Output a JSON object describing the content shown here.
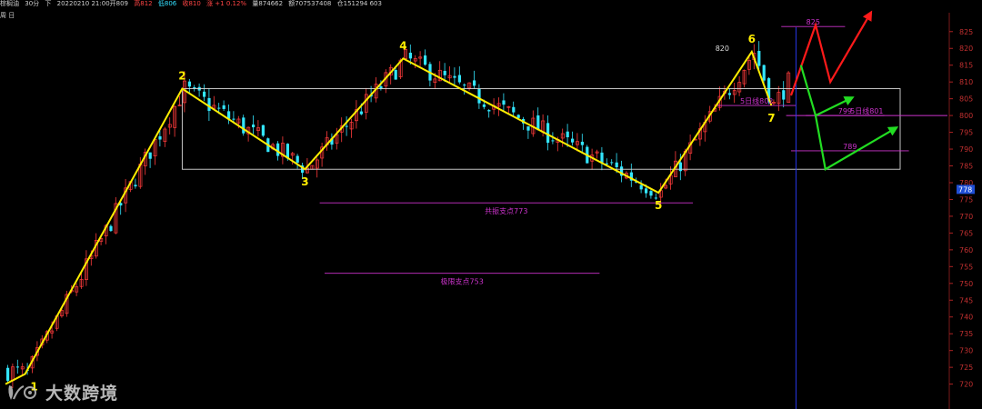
{
  "header": {
    "name": "棕榈油",
    "period": "30分",
    "arrow": "下",
    "datetime": "20220210 21:00开809",
    "high": "高812",
    "low": "低806",
    "close": "收810",
    "change": "涨 +1 0.12%",
    "volume": "量874662",
    "amount": "额707537408",
    "oi": "仓151294 603",
    "sub_label": "周 日"
  },
  "watermark": {
    "text": "大数跨境",
    "logo": "dashu-logo-icon"
  },
  "colors": {
    "background": "#000000",
    "up": "#ff3b3b",
    "down": "#33e6ff",
    "wave": "#ffee00",
    "level": "#cc33cc",
    "box": "#d8d8d8",
    "red_arrow": "#ff1a1a",
    "green_arrow": "#22dd22",
    "price_tag": "#1f4fd6",
    "vline": "#2a3cff"
  },
  "chart_data": {
    "type": "candlestick",
    "ylim": [
      718,
      829
    ],
    "y_ticks": [
      720,
      725,
      730,
      735,
      740,
      745,
      750,
      755,
      760,
      765,
      770,
      775,
      780,
      785,
      790,
      795,
      800,
      805,
      810,
      815,
      820,
      825
    ],
    "current_price": "778",
    "bar_count": 160,
    "wave_points": [
      {
        "label": "1",
        "bar": 4,
        "price": 723
      },
      {
        "label": "2",
        "bar": 36,
        "price": 808
      },
      {
        "label": "3",
        "bar": 61,
        "price": 784
      },
      {
        "label": "4",
        "bar": 81,
        "price": 817
      },
      {
        "label": "5",
        "bar": 133,
        "price": 777
      },
      {
        "label": "6",
        "bar": 152,
        "price": 819
      },
      {
        "label": "7",
        "bar": 156,
        "price": 803
      }
    ],
    "box": {
      "top": 808,
      "bottom": 784,
      "from_bar": 36,
      "to_bar": 160
    },
    "levels": [
      {
        "label": "共振支点773",
        "price": 774,
        "from_bar": 64,
        "to_bar": 140
      },
      {
        "label": "极限支点753",
        "price": 753,
        "from_bar": 65,
        "to_bar": 121
      },
      {
        "label": "5日线802",
        "price": 803,
        "from_bar": 145,
        "to_bar": 161
      },
      {
        "label": "5日线801",
        "price": 800,
        "from_bar": 159,
        "to_bar": 200
      },
      {
        "label": "825",
        "price": 826.5,
        "from_bar": 158,
        "to_bar": 171
      },
      {
        "label": "799",
        "price": 800,
        "from_bar": 163,
        "to_bar": 179
      },
      {
        "label": "789",
        "price": 789.5,
        "from_bar": 160,
        "to_bar": 184
      }
    ],
    "annotations": [
      {
        "label": "820",
        "price": 820
      }
    ],
    "scenarios": [
      {
        "name": "red",
        "path": [
          [
            160,
            806
          ],
          [
            165,
            827
          ],
          [
            168,
            810
          ],
          [
            176,
            830
          ]
        ]
      },
      {
        "name": "green-upper",
        "path": [
          [
            162,
            815
          ],
          [
            165,
            800
          ],
          [
            172,
            805
          ]
        ]
      },
      {
        "name": "green-lower",
        "path": [
          [
            165,
            800
          ],
          [
            167,
            784
          ],
          [
            181,
            796
          ]
        ]
      }
    ],
    "vline_bar": 161,
    "seed": 7
  }
}
